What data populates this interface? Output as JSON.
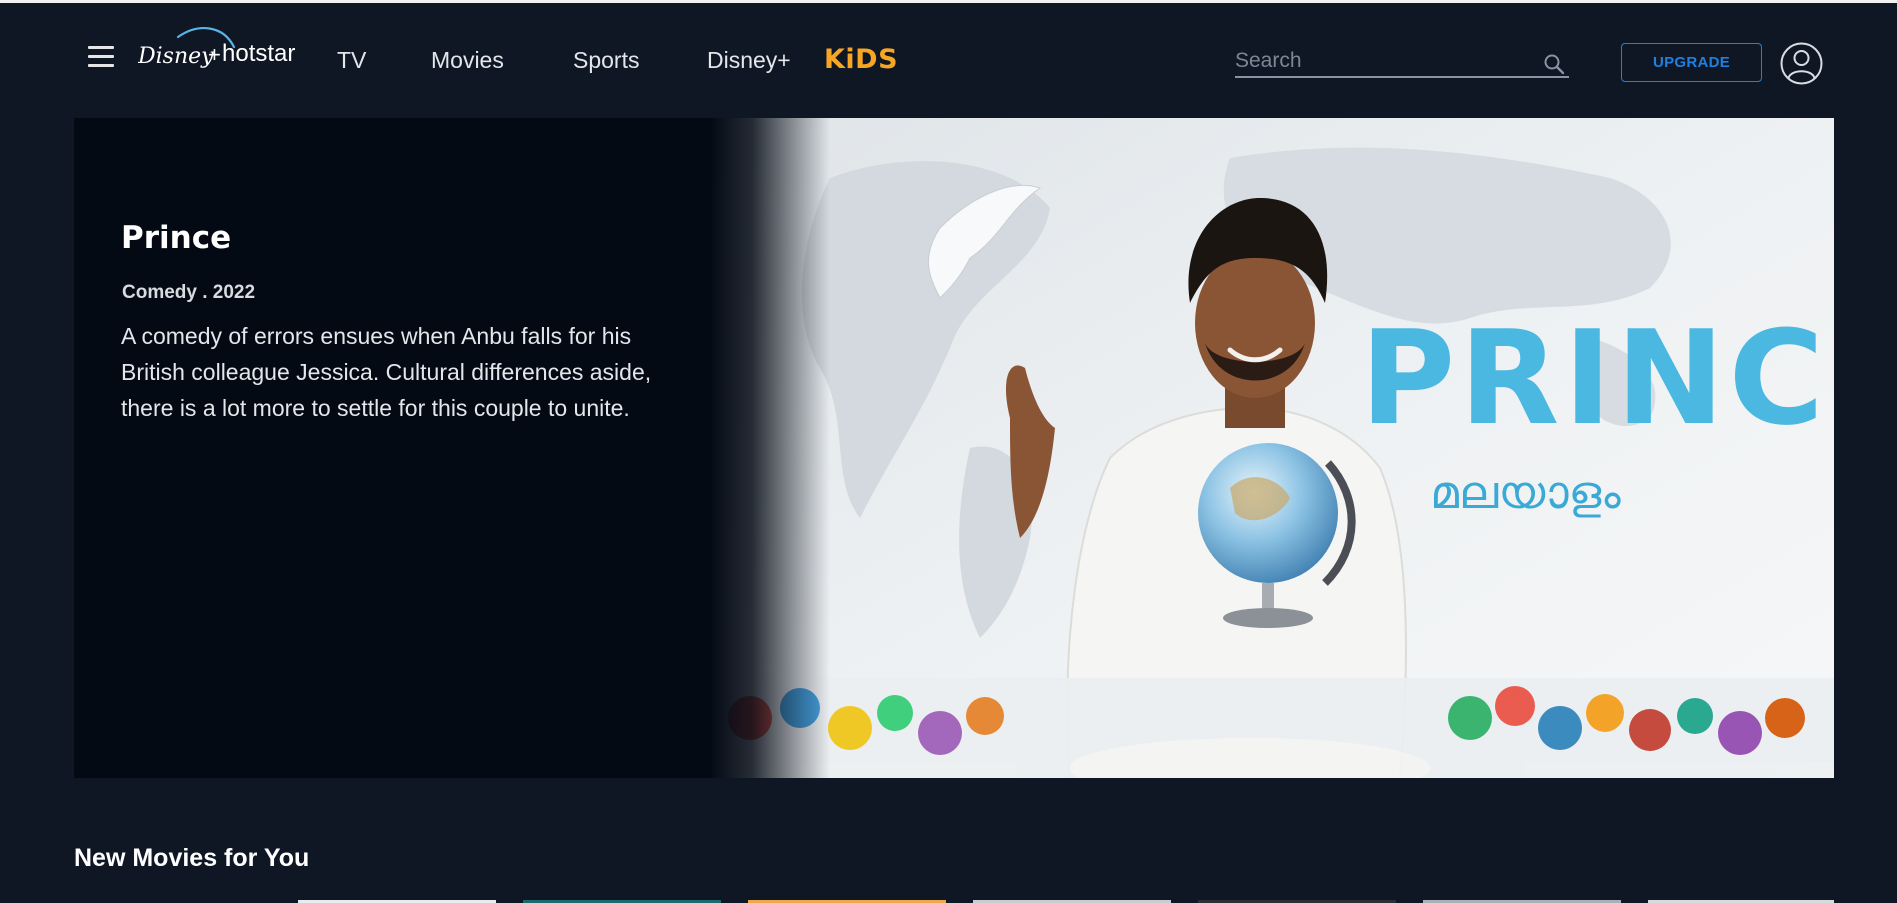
{
  "header": {
    "menu_icon": "hamburger-menu-icon",
    "logo_text": "Disney+ hotstar",
    "nav": [
      {
        "label": "TV"
      },
      {
        "label": "Movies"
      },
      {
        "label": "Sports"
      },
      {
        "label": "Disney+"
      },
      {
        "label": "KiDS"
      }
    ],
    "search": {
      "placeholder": "Search",
      "value": "",
      "icon": "search-icon"
    },
    "upgrade_label": "UPGRADE",
    "avatar_icon": "user-profile-icon"
  },
  "hero": {
    "title": "Prince",
    "meta": "Comedy . 2022",
    "description": "A comedy of errors ensues when Anbu falls for his British colleague Jessica. Cultural differences aside, there is a lot more to settle for this couple to unite.",
    "artwork": {
      "title_text": "PRINCE",
      "subtitle_text": "മലയാളം"
    }
  },
  "sections": [
    {
      "title": "New Movies for You"
    }
  ],
  "colors": {
    "background": "#0f1724",
    "hero_panel": "#040a14",
    "accent_blue": "#1f80e0",
    "kids_orange": "#f6a623",
    "poster_title_blue": "#4ab8e0"
  }
}
